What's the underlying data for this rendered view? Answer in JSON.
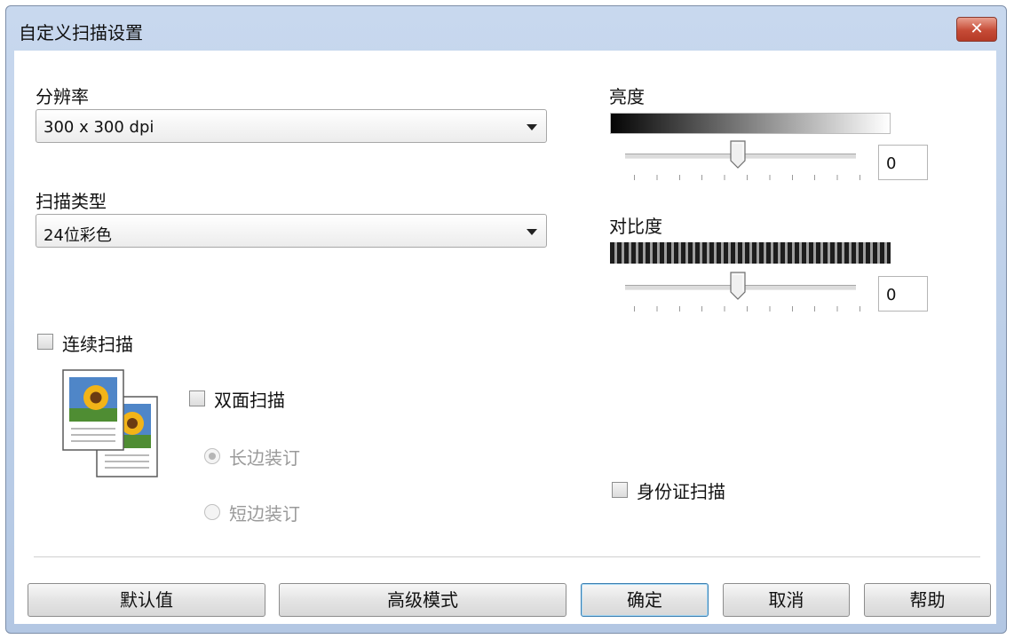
{
  "window": {
    "title": "自定义扫描设置",
    "close_label": "✕"
  },
  "resolution": {
    "label": "分辨率",
    "value": "300 x 300 dpi"
  },
  "scan_type": {
    "label": "扫描类型",
    "value": "24位彩色"
  },
  "brightness": {
    "label": "亮度",
    "value": "0",
    "level_percent": 50
  },
  "contrast": {
    "label": "对比度",
    "value": "0",
    "level_percent": 50
  },
  "continuous_scan": {
    "label": "连续扫描",
    "checked": false
  },
  "duplex": {
    "label": "双面扫描",
    "checked": false,
    "options": [
      {
        "label": "长边装订",
        "selected": true
      },
      {
        "label": "短边装订",
        "selected": false
      }
    ]
  },
  "id_card_scan": {
    "label": "身份证扫描",
    "checked": false
  },
  "buttons": {
    "default_label": "默认值",
    "advanced_label": "高级模式",
    "ok_label": "确定",
    "cancel_label": "取消",
    "help_label": "帮助"
  },
  "icons": {
    "duplex_pages": "two-pages-sunflower-icon"
  }
}
